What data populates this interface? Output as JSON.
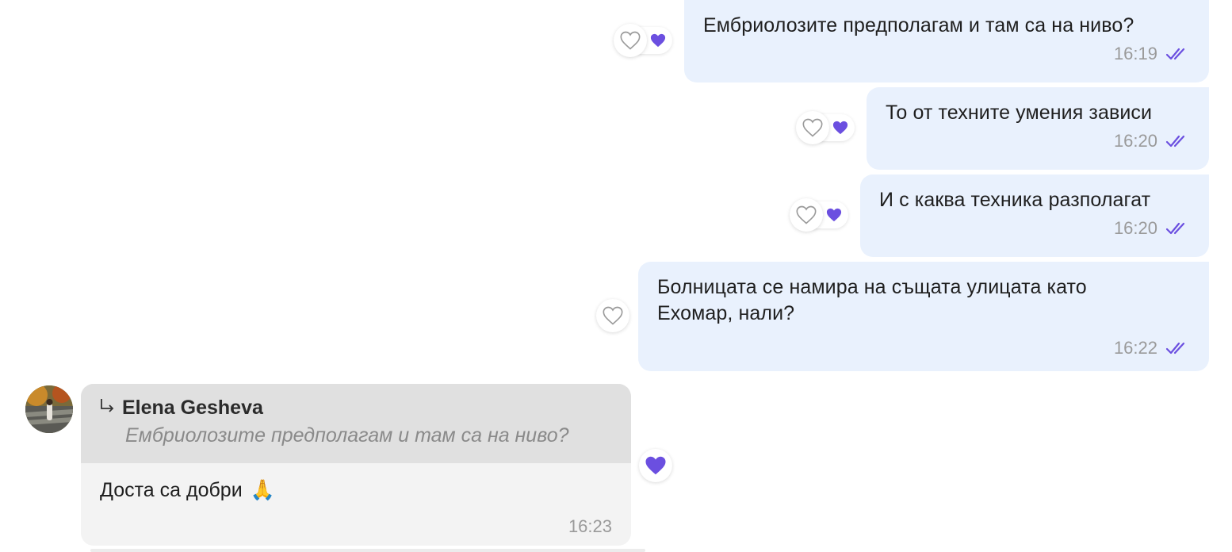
{
  "colors": {
    "outgoing_bubble": "#e9f1fd",
    "incoming_bubble": "#f3f3f3",
    "quote_bg": "#e0e0e0",
    "heart_purple": "#6b4fe0",
    "tick_purple": "#6b4fe0",
    "time_gray": "#9a9a9a"
  },
  "messages_out": [
    {
      "text": "Ембриолозите предполагам и там са на ниво?",
      "time": "16:19",
      "status_icon": "double-check-icon",
      "reaction_button": "heart-outline-icon",
      "reaction": "purple-heart-icon"
    },
    {
      "text": "То от техните умения зависи",
      "time": "16:20",
      "status_icon": "double-check-icon",
      "reaction_button": "heart-outline-icon",
      "reaction": "purple-heart-icon"
    },
    {
      "text": "И с каква техника разполагат",
      "time": "16:20",
      "status_icon": "double-check-icon",
      "reaction_button": "heart-outline-icon",
      "reaction": "purple-heart-icon"
    },
    {
      "text": "Болницата се намира на същата улицата като\nЕхомар, нали?",
      "time": "16:22",
      "status_icon": "double-check-icon",
      "reaction_button": "heart-outline-icon"
    }
  ],
  "message_in": {
    "reply_to": {
      "author": "Elena Gesheva",
      "text": "Ембриолозите предполагам и там са на ниво?"
    },
    "text": "Доста са добри",
    "emoji": "🙏",
    "time": "16:23",
    "reaction": "purple-heart-icon"
  }
}
